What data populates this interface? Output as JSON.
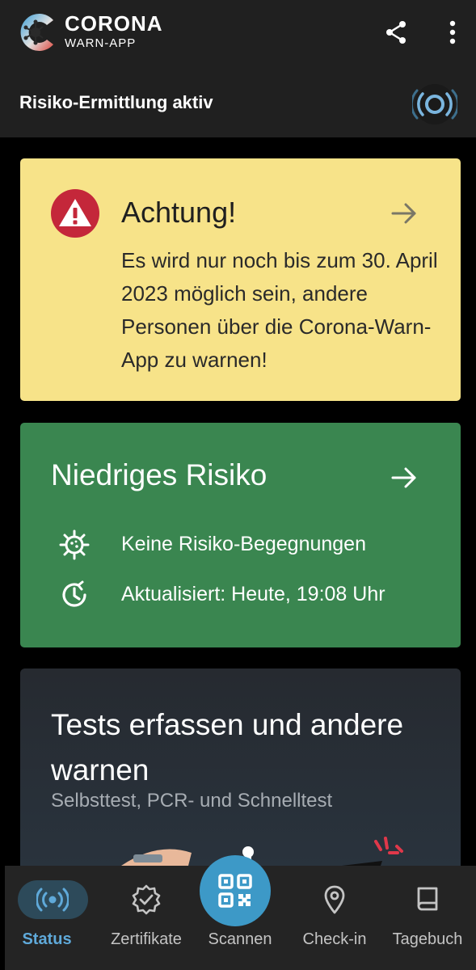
{
  "appbar": {
    "logo_line1": "CORONA",
    "logo_line2": "WARN-APP",
    "status_text": "Risiko-Ermittlung aktiv"
  },
  "warning_card": {
    "title": "Achtung!",
    "body": "Es wird nur noch bis zum 30. April 2023 möglich sein, andere Personen über die Corona-Warn-App zu warnen!",
    "background": "#f7e389",
    "icon_color": "#c4273a"
  },
  "risk_card": {
    "title": "Niedriges Risiko",
    "rows": [
      {
        "icon": "virus-icon",
        "text": "Keine Risiko-Begegnungen"
      },
      {
        "icon": "clock-refresh-icon",
        "text": "Aktualisiert: Heute, 19:08 Uhr"
      }
    ],
    "background": "#3a8650"
  },
  "tests_card": {
    "title": "Tests erfassen und andere warnen",
    "subtitle": "Selbsttest, PCR- und Schnelltest"
  },
  "bottom_nav": {
    "items": [
      {
        "label": "Status",
        "icon": "tracing-icon",
        "selected": true
      },
      {
        "label": "Zertifikate",
        "icon": "certificate-badge-icon",
        "selected": false
      },
      {
        "label": "Scannen",
        "icon": "qr-code-icon",
        "selected": false
      },
      {
        "label": "Check-in",
        "icon": "location-pin-icon",
        "selected": false
      },
      {
        "label": "Tagebuch",
        "icon": "book-icon",
        "selected": false
      }
    ],
    "accent": "#5fa9d9",
    "fab_color": "#3d99c7"
  }
}
